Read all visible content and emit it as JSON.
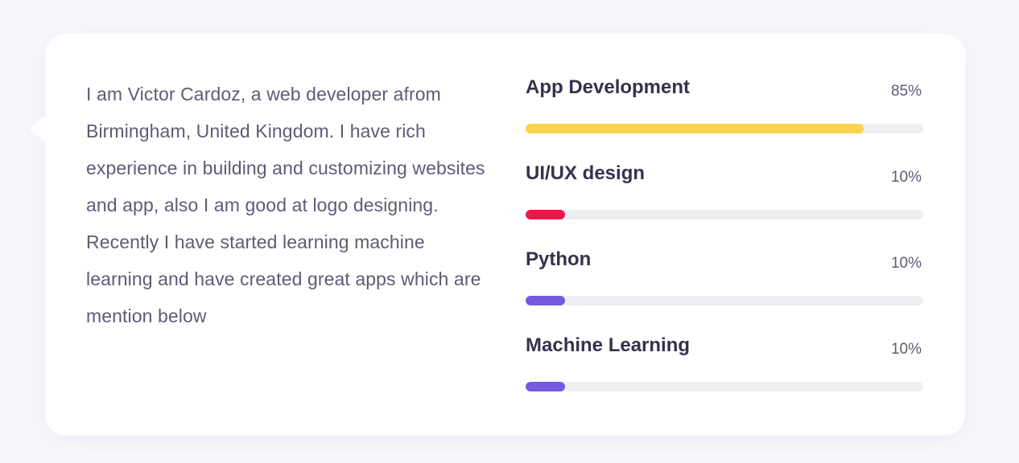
{
  "about": {
    "bio_text": "I am Victor Cardoz, a web developer afrom Birmingham, United Kingdom. I have rich experience in building and customizing websites and app, also I am good at logo designing. Recently I have started learning machine learning and have created great apps which are mention below"
  },
  "skills": [
    {
      "name": "App Development",
      "percent_label": "85%",
      "level": 0.85,
      "color": "#fdd24f"
    },
    {
      "name": "UI/UX design",
      "percent_label": "10%",
      "level": 0.1,
      "color": "#f3144a"
    },
    {
      "name": "Python",
      "percent_label": "10%",
      "level": 0.1,
      "color": "#735ae0"
    },
    {
      "name": "Machine Learning",
      "percent_label": "10%",
      "level": 0.1,
      "color": "#735ae0"
    }
  ]
}
